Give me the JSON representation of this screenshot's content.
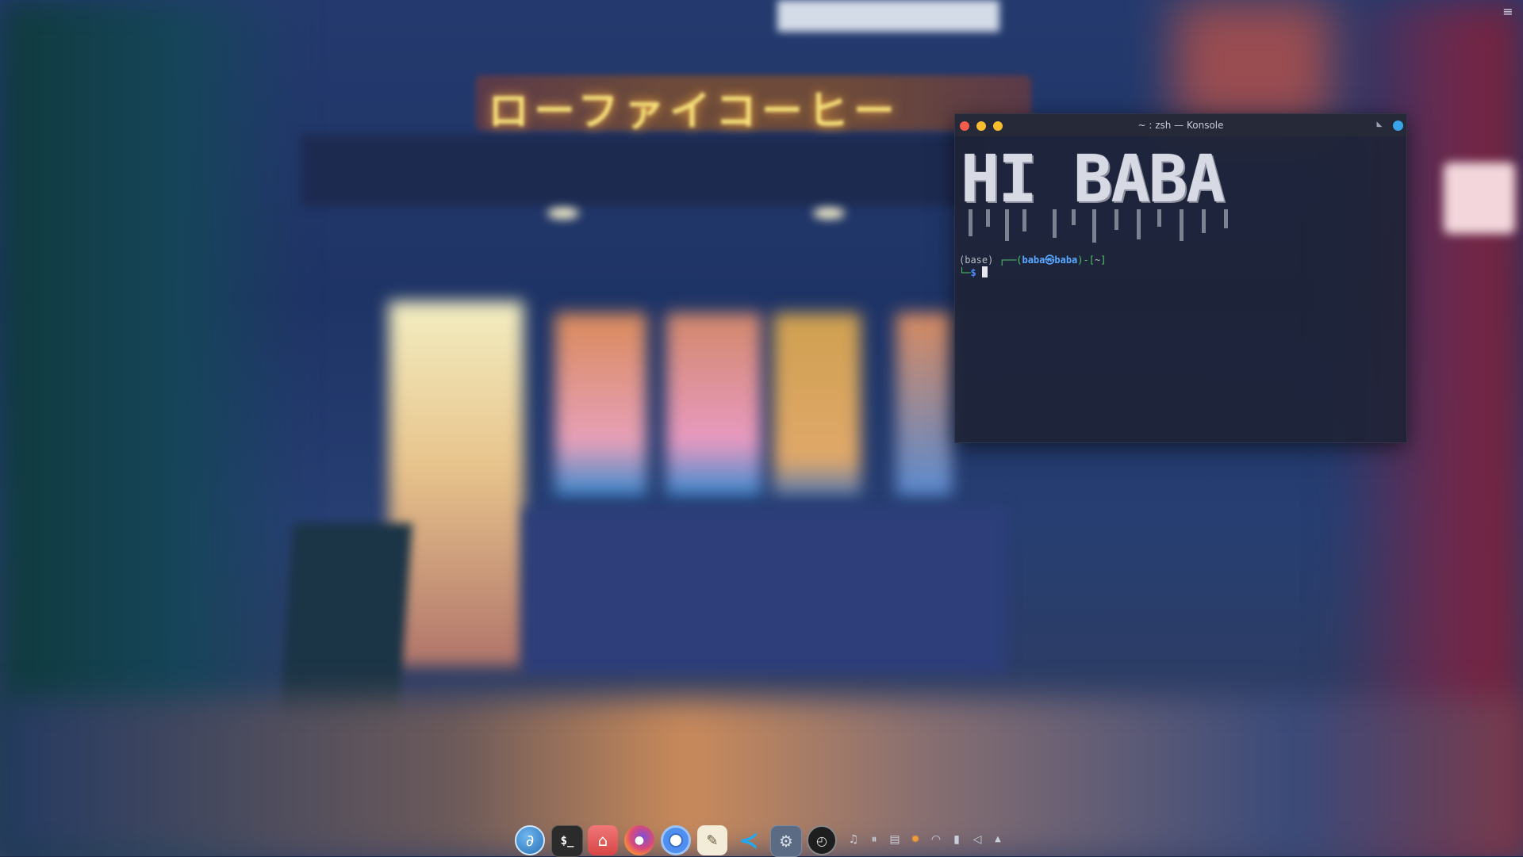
{
  "desktop": {
    "wallpaper_sign_text": "ローファイコーヒー",
    "menu_icon": "hamburger-menu-icon"
  },
  "konsole": {
    "title": "~ : zsh — Konsole",
    "buttons": {
      "close_color": "#f05b4a",
      "minimize_color": "#f6be2e",
      "maximize_color": "#f6be2e",
      "keep_above_color": "#3aa5e8"
    },
    "banner": "HI BABA",
    "prompt": {
      "env": "(base)",
      "frame_open": " ┌──(",
      "user_host": "baba㉿baba",
      "frame_close": ")-[",
      "cwd": "~",
      "bracket_close": "]",
      "line2_prefix": "└─",
      "symbol": "$"
    }
  },
  "dock": {
    "apps": [
      {
        "name": "elementary-launcher-icon"
      },
      {
        "name": "terminal-icon",
        "glyph": "$_"
      },
      {
        "name": "files-home-icon"
      },
      {
        "name": "firefox-icon"
      },
      {
        "name": "chromium-icon"
      },
      {
        "name": "text-editor-icon"
      },
      {
        "name": "vscode-icon"
      },
      {
        "name": "system-settings-icon"
      },
      {
        "name": "clock-icon"
      }
    ],
    "tray": [
      {
        "name": "notifications-bell-icon",
        "glyph": "♫"
      },
      {
        "name": "media-pause-icon",
        "glyph": "⏸"
      },
      {
        "name": "clipboard-icon",
        "glyph": "▤"
      },
      {
        "name": "weather-sun-icon",
        "glyph": "✹"
      },
      {
        "name": "wifi-icon",
        "glyph": "◠"
      },
      {
        "name": "battery-icon",
        "glyph": "▮"
      },
      {
        "name": "volume-icon",
        "glyph": "🔈"
      },
      {
        "name": "tray-expand-arrow-icon",
        "glyph": "▲"
      }
    ]
  }
}
